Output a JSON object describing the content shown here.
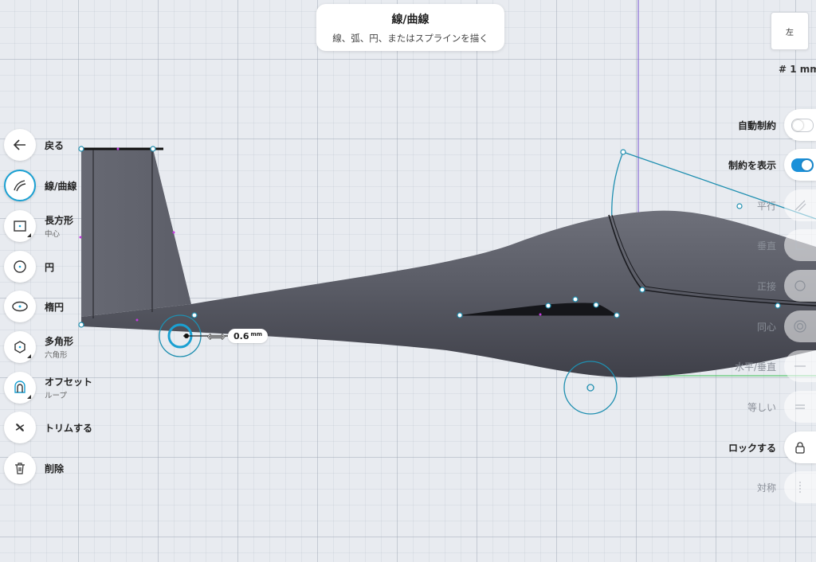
{
  "header": {
    "title": "線/曲線",
    "subtitle": "線、弧、円、またはスプラインを描く"
  },
  "view_cube": {
    "label": "左"
  },
  "grid": {
    "size_label": "# 1 mm"
  },
  "dimension": {
    "value": "0.6",
    "unit": "mm"
  },
  "left_toolbar": {
    "back": "戻る",
    "line": "線/曲線",
    "rect": "長方形",
    "rect_sub": "中心",
    "circle": "円",
    "ellipse": "楕円",
    "polygon": "多角形",
    "polygon_sub": "六角形",
    "offset": "オフセット",
    "offset_sub": "ループ",
    "trim": "トリムする",
    "delete": "削除"
  },
  "right_panel": {
    "auto_constraint": "自動制約",
    "show_constraints": "制約を表示",
    "parallel": "平行",
    "perpendicular": "垂直",
    "tangent": "正接",
    "concentric": "同心",
    "horiz_vert": "水平/垂直",
    "equal": "等しい",
    "lock": "ロックする",
    "symmetric": "対称"
  },
  "colors": {
    "accent": "#1aa0d2",
    "toggle_on": "#1a90d9",
    "body": "#5b5d67",
    "sketch_line": "#1f8fb0",
    "axis_vertical": "#8a6fd6",
    "axis_horizontal": "#3cbf55"
  }
}
